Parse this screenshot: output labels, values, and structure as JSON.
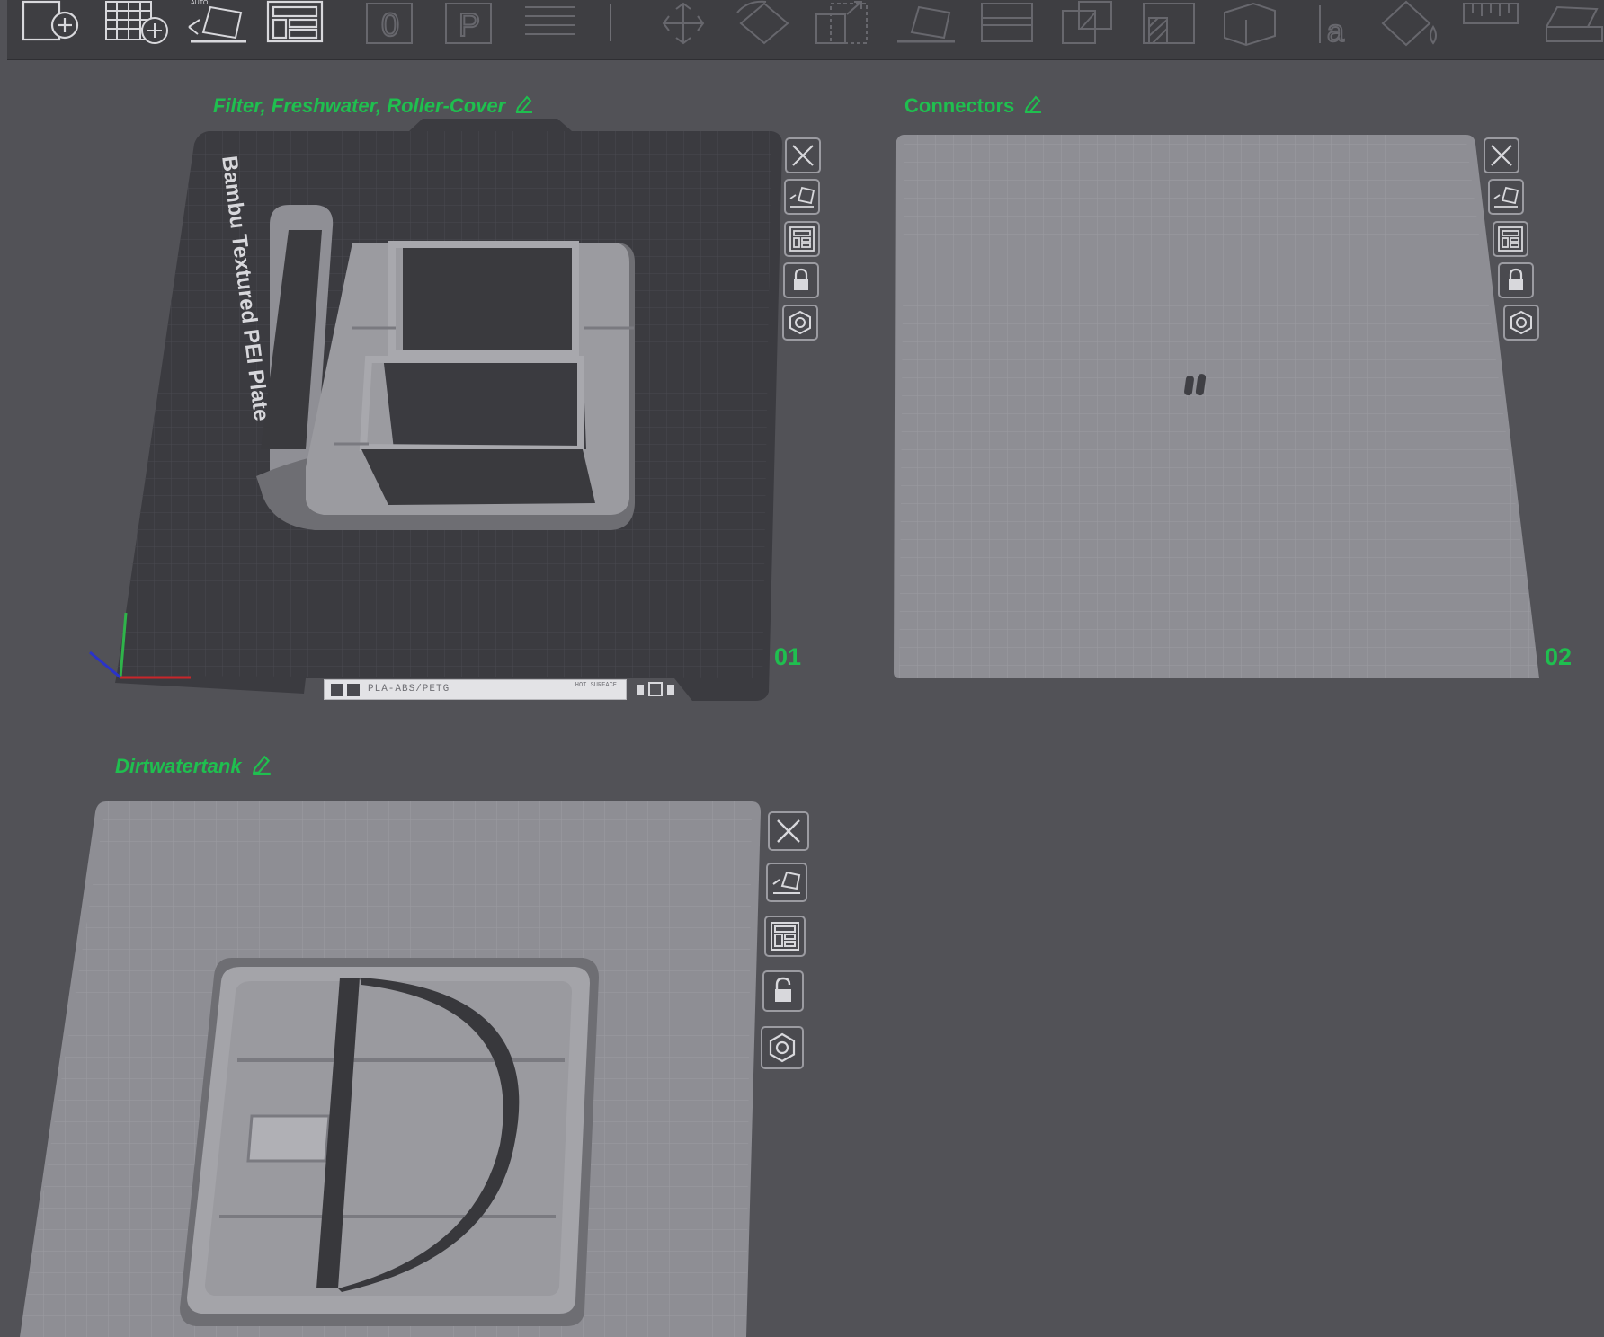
{
  "toolbar": {
    "icons": [
      "add-plate-icon",
      "add-grid-plate-icon",
      "auto-orient-icon",
      "arrange-icon",
      "zero-icon",
      "p-icon",
      "layers-icon",
      "move-icon",
      "rotate-icon",
      "scale-icon",
      "lay-on-face-icon",
      "cut-icon",
      "split-icon",
      "support-paint-icon",
      "seam-paint-icon",
      "text-icon",
      "color-paint-icon",
      "measure-icon",
      "assembly-icon"
    ],
    "auto_badge": "AUTO"
  },
  "plates": [
    {
      "number": "01",
      "name": "Filter, Freshwater, Roller-Cover",
      "bed_label": "Bambu Textured PEI Plate",
      "filament": "PLA-ABS/PETG",
      "hot_surface": "HOT SURFACE"
    },
    {
      "number": "02",
      "name": "Connectors"
    },
    {
      "name": "Dirtwatertank"
    }
  ],
  "side_buttons": [
    "delete-plate",
    "auto-orient",
    "arrange",
    "lock",
    "settings"
  ],
  "colors": {
    "background": "#525257",
    "accent_green": "#1fbf4f",
    "bed_dark": "#3b3b40",
    "bed_light": "#8e8e94",
    "model": "#a0a0a5"
  }
}
